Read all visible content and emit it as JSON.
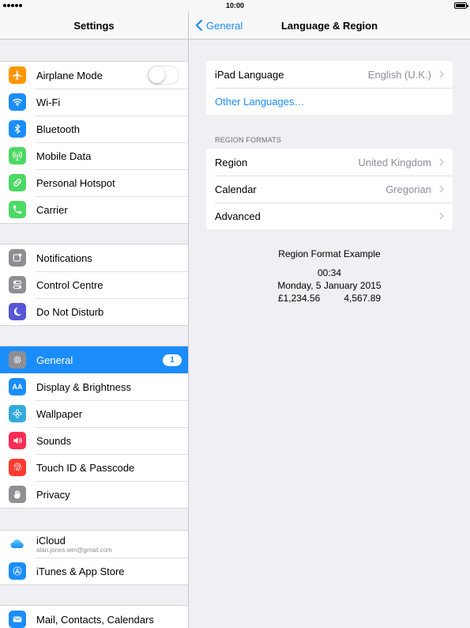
{
  "status_bar": {
    "time": "10:00"
  },
  "left_pane": {
    "title": "Settings",
    "groups": [
      [
        {
          "label": "Airplane Mode",
          "icon": "airplane-icon",
          "color": "#ff9500",
          "toggle": false
        },
        {
          "label": "Wi-Fi",
          "icon": "wifi-icon",
          "color": "#1b8dfa"
        },
        {
          "label": "Bluetooth",
          "icon": "bluetooth-icon",
          "color": "#1b8dfa"
        },
        {
          "label": "Mobile Data",
          "icon": "antenna-icon",
          "color": "#4cd964"
        },
        {
          "label": "Personal Hotspot",
          "icon": "hotspot-icon",
          "color": "#4cd964"
        },
        {
          "label": "Carrier",
          "icon": "phone-icon",
          "color": "#4cd964"
        }
      ],
      [
        {
          "label": "Notifications",
          "icon": "notifications-icon",
          "color": "#8e8e93"
        },
        {
          "label": "Control Centre",
          "icon": "control-centre-icon",
          "color": "#8e8e93"
        },
        {
          "label": "Do Not Disturb",
          "icon": "moon-icon",
          "color": "#5856d6"
        }
      ],
      [
        {
          "label": "General",
          "icon": "gear-icon",
          "color": "#8e8e93",
          "badge": "1",
          "selected": true
        },
        {
          "label": "Display & Brightness",
          "icon": "text-size-icon",
          "color": "#1b8dfa",
          "glyph": "AA"
        },
        {
          "label": "Wallpaper",
          "icon": "wallpaper-icon",
          "color": "#34aadc"
        },
        {
          "label": "Sounds",
          "icon": "speaker-icon",
          "color": "#ff2d55"
        },
        {
          "label": "Touch ID & Passcode",
          "icon": "fingerprint-icon",
          "color": "#ff3b30"
        },
        {
          "label": "Privacy",
          "icon": "hand-icon",
          "color": "#8e8e93"
        }
      ],
      [
        {
          "label": "iCloud",
          "sublabel": "alan.jones.wm@gmail.com",
          "icon": "cloud-icon",
          "color": "#ffffff"
        },
        {
          "label": "iTunes & App Store",
          "icon": "app-store-icon",
          "color": "#1b8dfa"
        }
      ],
      [
        {
          "label": "Mail, Contacts, Calendars",
          "icon": "mail-icon",
          "color": "#1b8dfa"
        }
      ]
    ]
  },
  "right_pane": {
    "back_label": "General",
    "title": "Language & Region",
    "language_card": {
      "ipad_language_label": "iPad Language",
      "ipad_language_value": "English (U.K.)",
      "other_languages_label": "Other Languages…"
    },
    "region_formats_header": "REGION FORMATS",
    "region_card": {
      "region_label": "Region",
      "region_value": "United Kingdom",
      "calendar_label": "Calendar",
      "calendar_value": "Gregorian",
      "advanced_label": "Advanced"
    },
    "example": {
      "title": "Region Format Example",
      "time": "00:34",
      "date": "Monday, 5 January 2015",
      "currency": "£1,234.56",
      "number": "4,567.89"
    }
  }
}
